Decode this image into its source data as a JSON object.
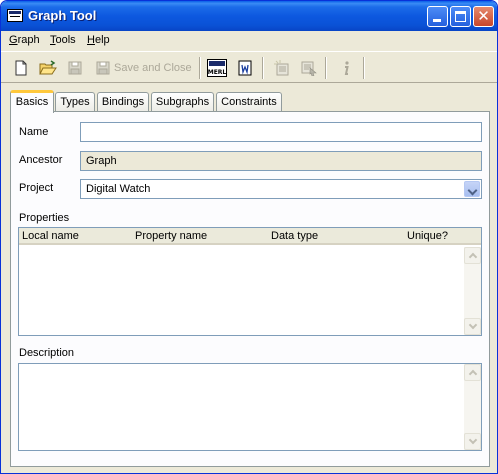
{
  "window": {
    "title": "Graph Tool"
  },
  "menu": {
    "items": [
      {
        "label": "Graph",
        "mnemonic": "G",
        "rest": "raph"
      },
      {
        "label": "Tools",
        "mnemonic": "T",
        "rest": "ools"
      },
      {
        "label": "Help",
        "mnemonic": "H",
        "rest": "elp"
      }
    ]
  },
  "toolbar": {
    "save_and_close_label": "Save and Close",
    "icons": [
      "new-file-icon",
      "open-folder-icon",
      "save-icon",
      "save-close-icon",
      "merl-icon",
      "word-doc-icon",
      "generate-icon",
      "select-icon",
      "info-icon"
    ]
  },
  "tabs": [
    "Basics",
    "Types",
    "Bindings",
    "Subgraphs",
    "Constraints"
  ],
  "form": {
    "name_label": "Name",
    "name_value": "",
    "ancestor_label": "Ancestor",
    "ancestor_value": "Graph",
    "project_label": "Project",
    "project_value": "Digital Watch",
    "properties_label": "Properties",
    "properties_columns": [
      "Local name",
      "Property name",
      "Data type",
      "Unique?"
    ],
    "description_label": "Description",
    "description_value": ""
  },
  "colors": {
    "titlebar": "#0a52d6",
    "active_tab_accent": "#ffc83c",
    "field_border": "#7f9db9",
    "window_bg": "#ece9d8"
  }
}
